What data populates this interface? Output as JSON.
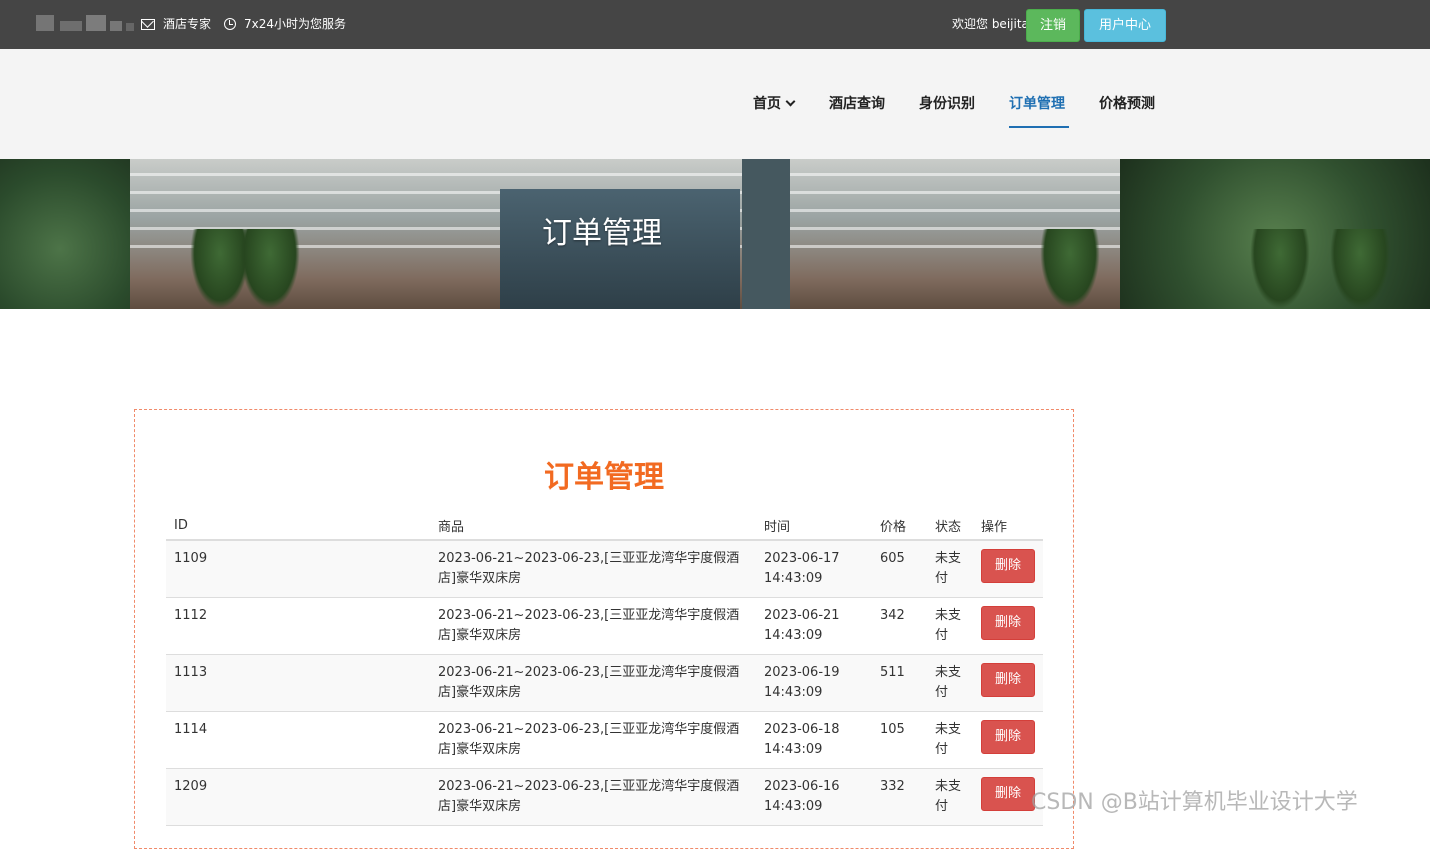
{
  "topbar": {
    "tagline": "酒店专家",
    "service": "7x24小时为您服务",
    "welcome": "欢迎您 beijita",
    "logout_label": "注销",
    "user_center_label": "用户中心"
  },
  "nav": {
    "items": [
      {
        "label": "首页"
      },
      {
        "label": "酒店查询"
      },
      {
        "label": "身份识别"
      },
      {
        "label": "订单管理"
      },
      {
        "label": "价格预测"
      }
    ],
    "active": "订单管理"
  },
  "banner": {
    "title": "订单管理"
  },
  "orders": {
    "title": "订单管理",
    "columns": [
      "ID",
      "商品",
      "时间",
      "价格",
      "状态",
      "操作"
    ],
    "delete_label": "删除",
    "rows": [
      {
        "id": "1109",
        "product": "2023-06-21~2023-06-23,[三亚亚龙湾华宇度假酒店]豪华双床房",
        "date": "2023-06-17",
        "time": "14:43:09",
        "price": "605",
        "status": "未支付"
      },
      {
        "id": "1112",
        "product": "2023-06-21~2023-06-23,[三亚亚龙湾华宇度假酒店]豪华双床房",
        "date": "2023-06-21",
        "time": "14:43:09",
        "price": "342",
        "status": "未支付"
      },
      {
        "id": "1113",
        "product": "2023-06-21~2023-06-23,[三亚亚龙湾华宇度假酒店]豪华双床房",
        "date": "2023-06-19",
        "time": "14:43:09",
        "price": "511",
        "status": "未支付"
      },
      {
        "id": "1114",
        "product": "2023-06-21~2023-06-23,[三亚亚龙湾华宇度假酒店]豪华双床房",
        "date": "2023-06-18",
        "time": "14:43:09",
        "price": "105",
        "status": "未支付"
      },
      {
        "id": "1209",
        "product": "2023-06-21~2023-06-23,[三亚亚龙湾华宇度假酒店]豪华双床房",
        "date": "2023-06-16",
        "time": "14:43:09",
        "price": "332",
        "status": "未支付"
      }
    ]
  },
  "watermark": "CSDN @B站计算机毕业设计大学",
  "colors": {
    "topbar": "#454545",
    "logout": "#5cb85c",
    "user_center": "#5bc0de",
    "nav_active": "#1f6fb2",
    "title_orange": "#f26a21",
    "delete": "#d9534f"
  }
}
